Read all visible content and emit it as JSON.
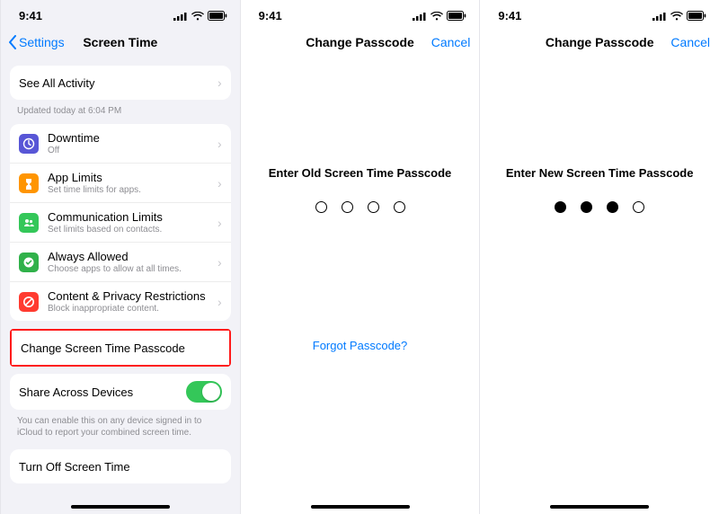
{
  "statusbar": {
    "time": "9:41"
  },
  "screen1": {
    "back": "Settings",
    "title": "Screen Time",
    "see_all": "See All Activity",
    "updated": "Updated today at 6:04 PM",
    "items": [
      {
        "title": "Downtime",
        "sub": "Off"
      },
      {
        "title": "App Limits",
        "sub": "Set time limits for apps."
      },
      {
        "title": "Communication Limits",
        "sub": "Set limits based on contacts."
      },
      {
        "title": "Always Allowed",
        "sub": "Choose apps to allow at all times."
      },
      {
        "title": "Content & Privacy Restrictions",
        "sub": "Block inappropriate content."
      }
    ],
    "change_passcode": "Change Screen Time Passcode",
    "share_devices": "Share Across Devices",
    "share_footer": "You can enable this on any device signed in to iCloud to report your combined screen time.",
    "turn_off": "Turn Off Screen Time"
  },
  "screen2": {
    "title": "Change Passcode",
    "cancel": "Cancel",
    "prompt": "Enter Old Screen Time Passcode",
    "filled": [
      false,
      false,
      false,
      false
    ],
    "forgot": "Forgot Passcode?"
  },
  "screen3": {
    "title": "Change Passcode",
    "cancel": "Cancel",
    "prompt": "Enter New Screen Time Passcode",
    "filled": [
      true,
      true,
      true,
      false
    ]
  }
}
